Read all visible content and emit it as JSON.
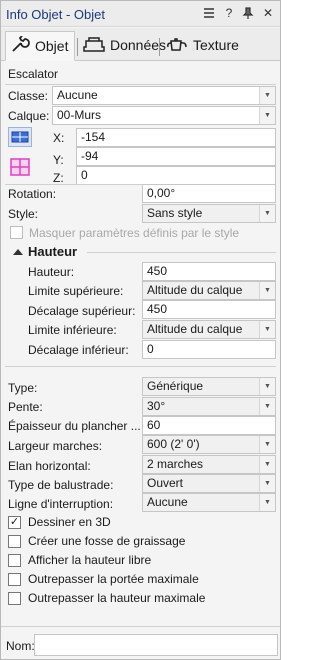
{
  "window": {
    "title": "Info Objet - Objet",
    "controls": [
      "≡",
      "?",
      "📌",
      "✕"
    ]
  },
  "tabs": [
    {
      "label": "Objet",
      "icon": "wrench-icon",
      "active": true
    },
    {
      "label": "Données",
      "icon": "sofa-icon",
      "active": false
    },
    {
      "label": "Texture",
      "icon": "teapot-icon",
      "active": false
    }
  ],
  "object_type": "Escalator",
  "classe": {
    "label": "Classe:",
    "value": "Aucune"
  },
  "calque": {
    "label": "Calque:",
    "value": "00-Murs"
  },
  "coords": {
    "x": {
      "label": "X:",
      "value": "-154"
    },
    "y": {
      "label": "Y:",
      "value": "-94"
    },
    "z": {
      "label": "Z:",
      "value": "0"
    }
  },
  "rotation": {
    "label": "Rotation:",
    "value": "0,00°"
  },
  "style": {
    "label": "Style:",
    "value": "Sans style"
  },
  "masquer": {
    "label": "Masquer paramètres définis par le style"
  },
  "hauteur_section": {
    "title": "Hauteur"
  },
  "hauteur": {
    "label": "Hauteur:",
    "value": "450"
  },
  "limite_sup": {
    "label": "Limite supérieure:",
    "value": "Altitude du calque"
  },
  "decalage_sup": {
    "label": "Décalage supérieur:",
    "value": "450"
  },
  "limite_inf": {
    "label": "Limite inférieure:",
    "value": "Altitude du calque"
  },
  "decalage_inf": {
    "label": "Décalage inférieur:",
    "value": "0"
  },
  "type": {
    "label": "Type:",
    "value": "Générique"
  },
  "pente": {
    "label": "Pente:",
    "value": "30°"
  },
  "epaisseur": {
    "label": "Épaisseur du plancher ...",
    "value": "60"
  },
  "largeur": {
    "label": "Largeur marches:",
    "value": "600 (2' 0')"
  },
  "elan": {
    "label": "Elan horizontal:",
    "value": "2 marches"
  },
  "balustrade": {
    "label": "Type de balustrade:",
    "value": "Ouvert"
  },
  "ligne": {
    "label": "Ligne d'interruption:",
    "value": "Aucune"
  },
  "checks": [
    {
      "label": "Dessiner en 3D",
      "checked": true
    },
    {
      "label": "Créer une fosse de graissage",
      "checked": false
    },
    {
      "label": "Afficher la hauteur libre",
      "checked": false
    },
    {
      "label": "Outrepasser la portée maximale",
      "checked": false
    },
    {
      "label": "Outrepasser la hauteur maximale",
      "checked": false
    }
  ],
  "nom": {
    "label": "Nom:",
    "value": ""
  },
  "colors": {
    "title": "#1b3a78",
    "accent": "#3b6fd8",
    "grid_icon": "#e040c0"
  }
}
